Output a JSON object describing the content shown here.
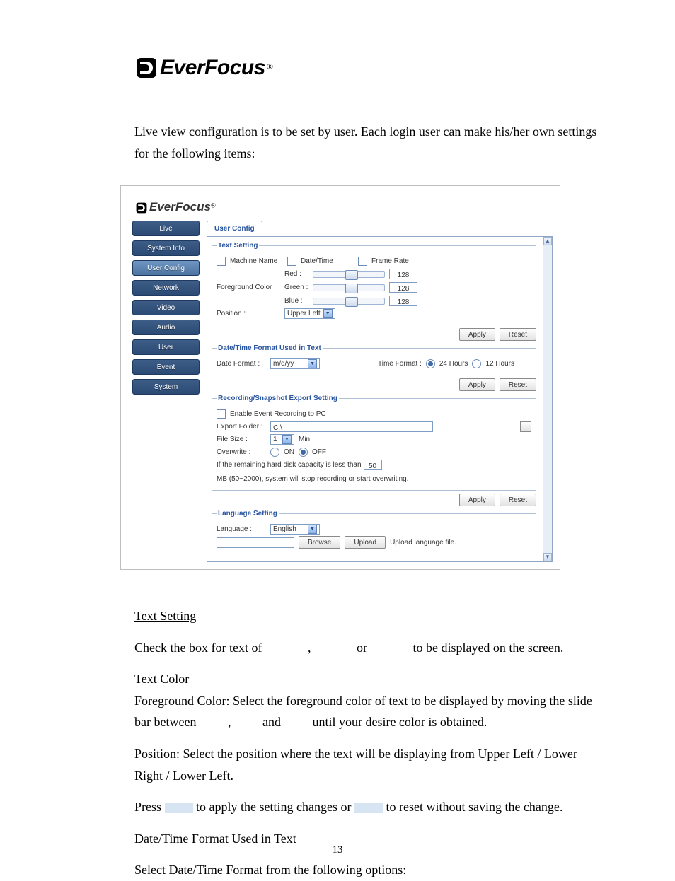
{
  "logo": {
    "brand": "EverFocus",
    "reg": "®"
  },
  "intro": "Live view configuration is to be set by user. Each login user can make his/her own settings for the following items:",
  "shot": {
    "sidebar": [
      {
        "label": "Live",
        "active": false
      },
      {
        "label": "System Info",
        "active": false
      },
      {
        "label": "User Config",
        "active": true
      },
      {
        "label": "Network",
        "active": false
      },
      {
        "label": "Video",
        "active": false
      },
      {
        "label": "Audio",
        "active": false
      },
      {
        "label": "User",
        "active": false
      },
      {
        "label": "Event",
        "active": false
      },
      {
        "label": "System",
        "active": false
      }
    ],
    "tab": "User Config",
    "text_setting": {
      "legend": "Text Setting",
      "machine_name": "Machine Name",
      "date_time": "Date/Time",
      "frame_rate": "Frame Rate",
      "fg_label": "Foreground Color :",
      "red": "Red :",
      "green": "Green :",
      "blue": "Blue :",
      "rgb_value": "128",
      "pos_label": "Position :",
      "pos_value": "Upper Left"
    },
    "dt": {
      "legend": "Date/Time Format Used in Text",
      "df_label": "Date Format :",
      "df_value": "m/d/yy",
      "tf_label": "Time Format :",
      "tf_24": "24 Hours",
      "tf_12": "12 Hours"
    },
    "rec": {
      "legend": "Recording/Snapshot Export Setting",
      "enable": "Enable Event Recording to PC",
      "ef_label": "Export Folder :",
      "ef_value": "C:\\",
      "fs_label": "File Size :",
      "fs_value": "1",
      "fs_unit": "Min",
      "ow_label": "Overwrite :",
      "on": "ON",
      "off": "OFF",
      "note_a": "If the remaining hard disk capacity is less than",
      "note_val": "50",
      "note_b": "MB (50~2000), system will stop recording or start overwriting."
    },
    "lang": {
      "legend": "Language Setting",
      "label": "Language :",
      "value": "English",
      "browse": "Browse",
      "upload": "Upload",
      "msg": "Upload language file."
    },
    "apply": "Apply",
    "reset": "Reset"
  },
  "body": {
    "h_text_setting": "Text Setting",
    "p1a": "Check the box for text of ",
    "p1b": ", ",
    "p1c": "or ",
    "p1d": "to be displayed on the screen.",
    "h_text_color": "Text Color",
    "p2": "Foreground Color: Select the foreground color of text to be displayed by moving the slide bar between ",
    "p2b": ", ",
    "p2c": "and ",
    "p2d": "until your desire color is obtained.",
    "p3": "Position: Select the position where the text will be displaying from Upper Left / Lower Right / Lower Left.",
    "p4a": "Press ",
    "p4b": " to apply the setting changes or ",
    "p4c": " to reset without saving the change.",
    "h_dt": "Date/Time Format Used in Text",
    "p5": "Select Date/Time Format from the following options:"
  },
  "page_number": "13"
}
